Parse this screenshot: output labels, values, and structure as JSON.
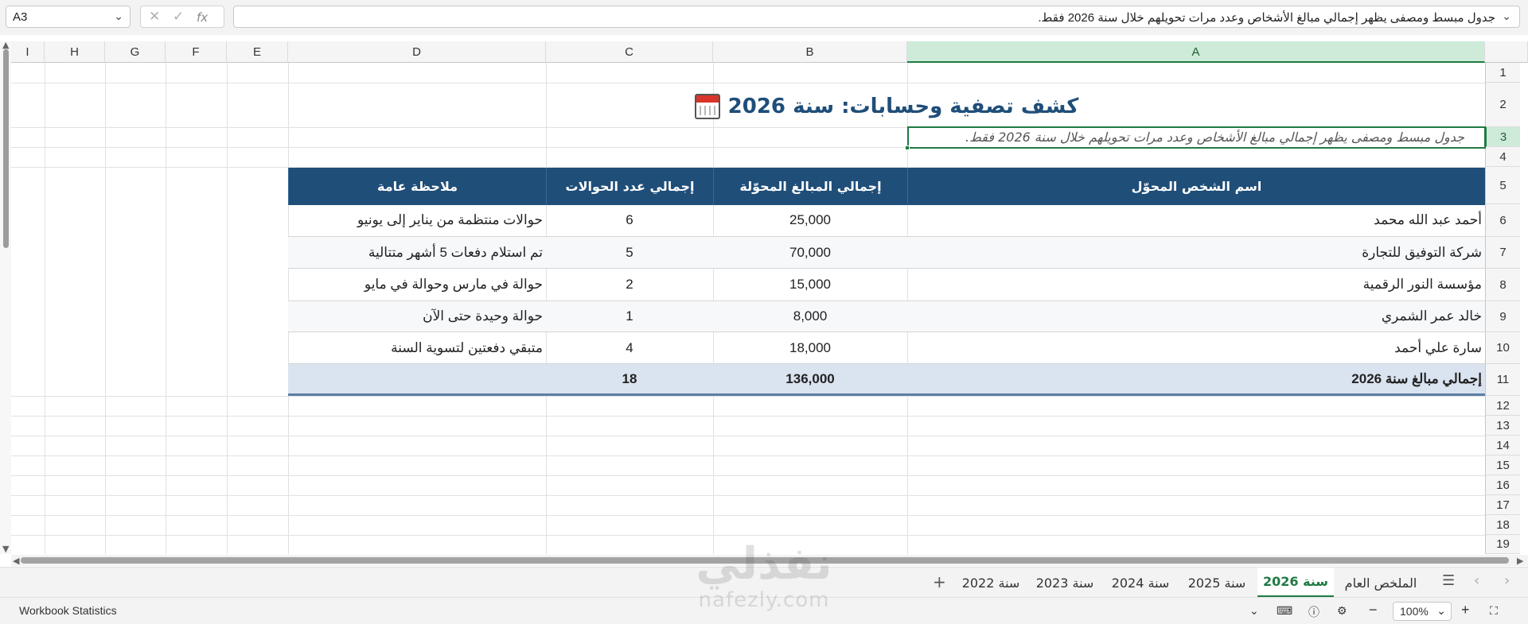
{
  "formula_bar": {
    "name_box": "A3",
    "content": "جدول مبسط ومصفى يظهر إجمالي مبالغ الأشخاص وعدد مرات تحويلهم خلال سنة 2026 فقط.",
    "fx_label": "fx"
  },
  "columns": [
    "I",
    "H",
    "G",
    "F",
    "E",
    "D",
    "C",
    "B",
    "A"
  ],
  "rows": [
    "1",
    "2",
    "3",
    "4",
    "5",
    "6",
    "7",
    "8",
    "9",
    "10",
    "11",
    "12",
    "13",
    "14",
    "15",
    "16",
    "17",
    "18",
    "19"
  ],
  "sheet": {
    "title": "كشف تصفية وحسابات: سنة 2026",
    "title_icon": "calendar-icon",
    "subtitle": "جدول مبسط ومصفى يظهر إجمالي مبالغ الأشخاص وعدد مرات تحويلهم خلال سنة 2026 فقط.",
    "headers": {
      "name": "اسم الشخص المحوّل",
      "amount": "إجمالي المبالغ المحوّلة",
      "count": "إجمالي عدد الحوالات",
      "note": "ملاحظة عامة"
    },
    "records": [
      {
        "name": "أحمد عبد الله محمد",
        "amount": "25,000",
        "count": "6",
        "note": "حوالات منتظمة من يناير إلى يونيو"
      },
      {
        "name": "شركة التوفيق للتجارة",
        "amount": "70,000",
        "count": "5",
        "note": "تم استلام دفعات 5 أشهر متتالية"
      },
      {
        "name": "مؤسسة النور الرقمية",
        "amount": "15,000",
        "count": "2",
        "note": "حوالة في مارس وحوالة في مايو"
      },
      {
        "name": "خالد عمر الشمري",
        "amount": "8,000",
        "count": "1",
        "note": "حوالة وحيدة حتى الآن"
      },
      {
        "name": "سارة علي أحمد",
        "amount": "18,000",
        "count": "4",
        "note": "متبقي دفعتين لتسوية السنة"
      }
    ],
    "total": {
      "label": "إجمالي مبالغ سنة 2026",
      "amount": "136,000",
      "count": "18"
    }
  },
  "tabs": {
    "add": "+",
    "items": [
      "سنة 2022",
      "سنة 2023",
      "سنة 2024",
      "سنة 2025",
      "سنة 2026",
      "الملخص العام"
    ],
    "active": "سنة 2026"
  },
  "status_bar": {
    "workbook_statistics": "Workbook Statistics",
    "zoom": "100%"
  },
  "watermark": {
    "logo": "نفذلي",
    "url": "nafezly.com"
  },
  "colors": {
    "header_blue": "#1f4e79",
    "total_row": "#dae3f0",
    "selection_green": "#1f7a43"
  }
}
